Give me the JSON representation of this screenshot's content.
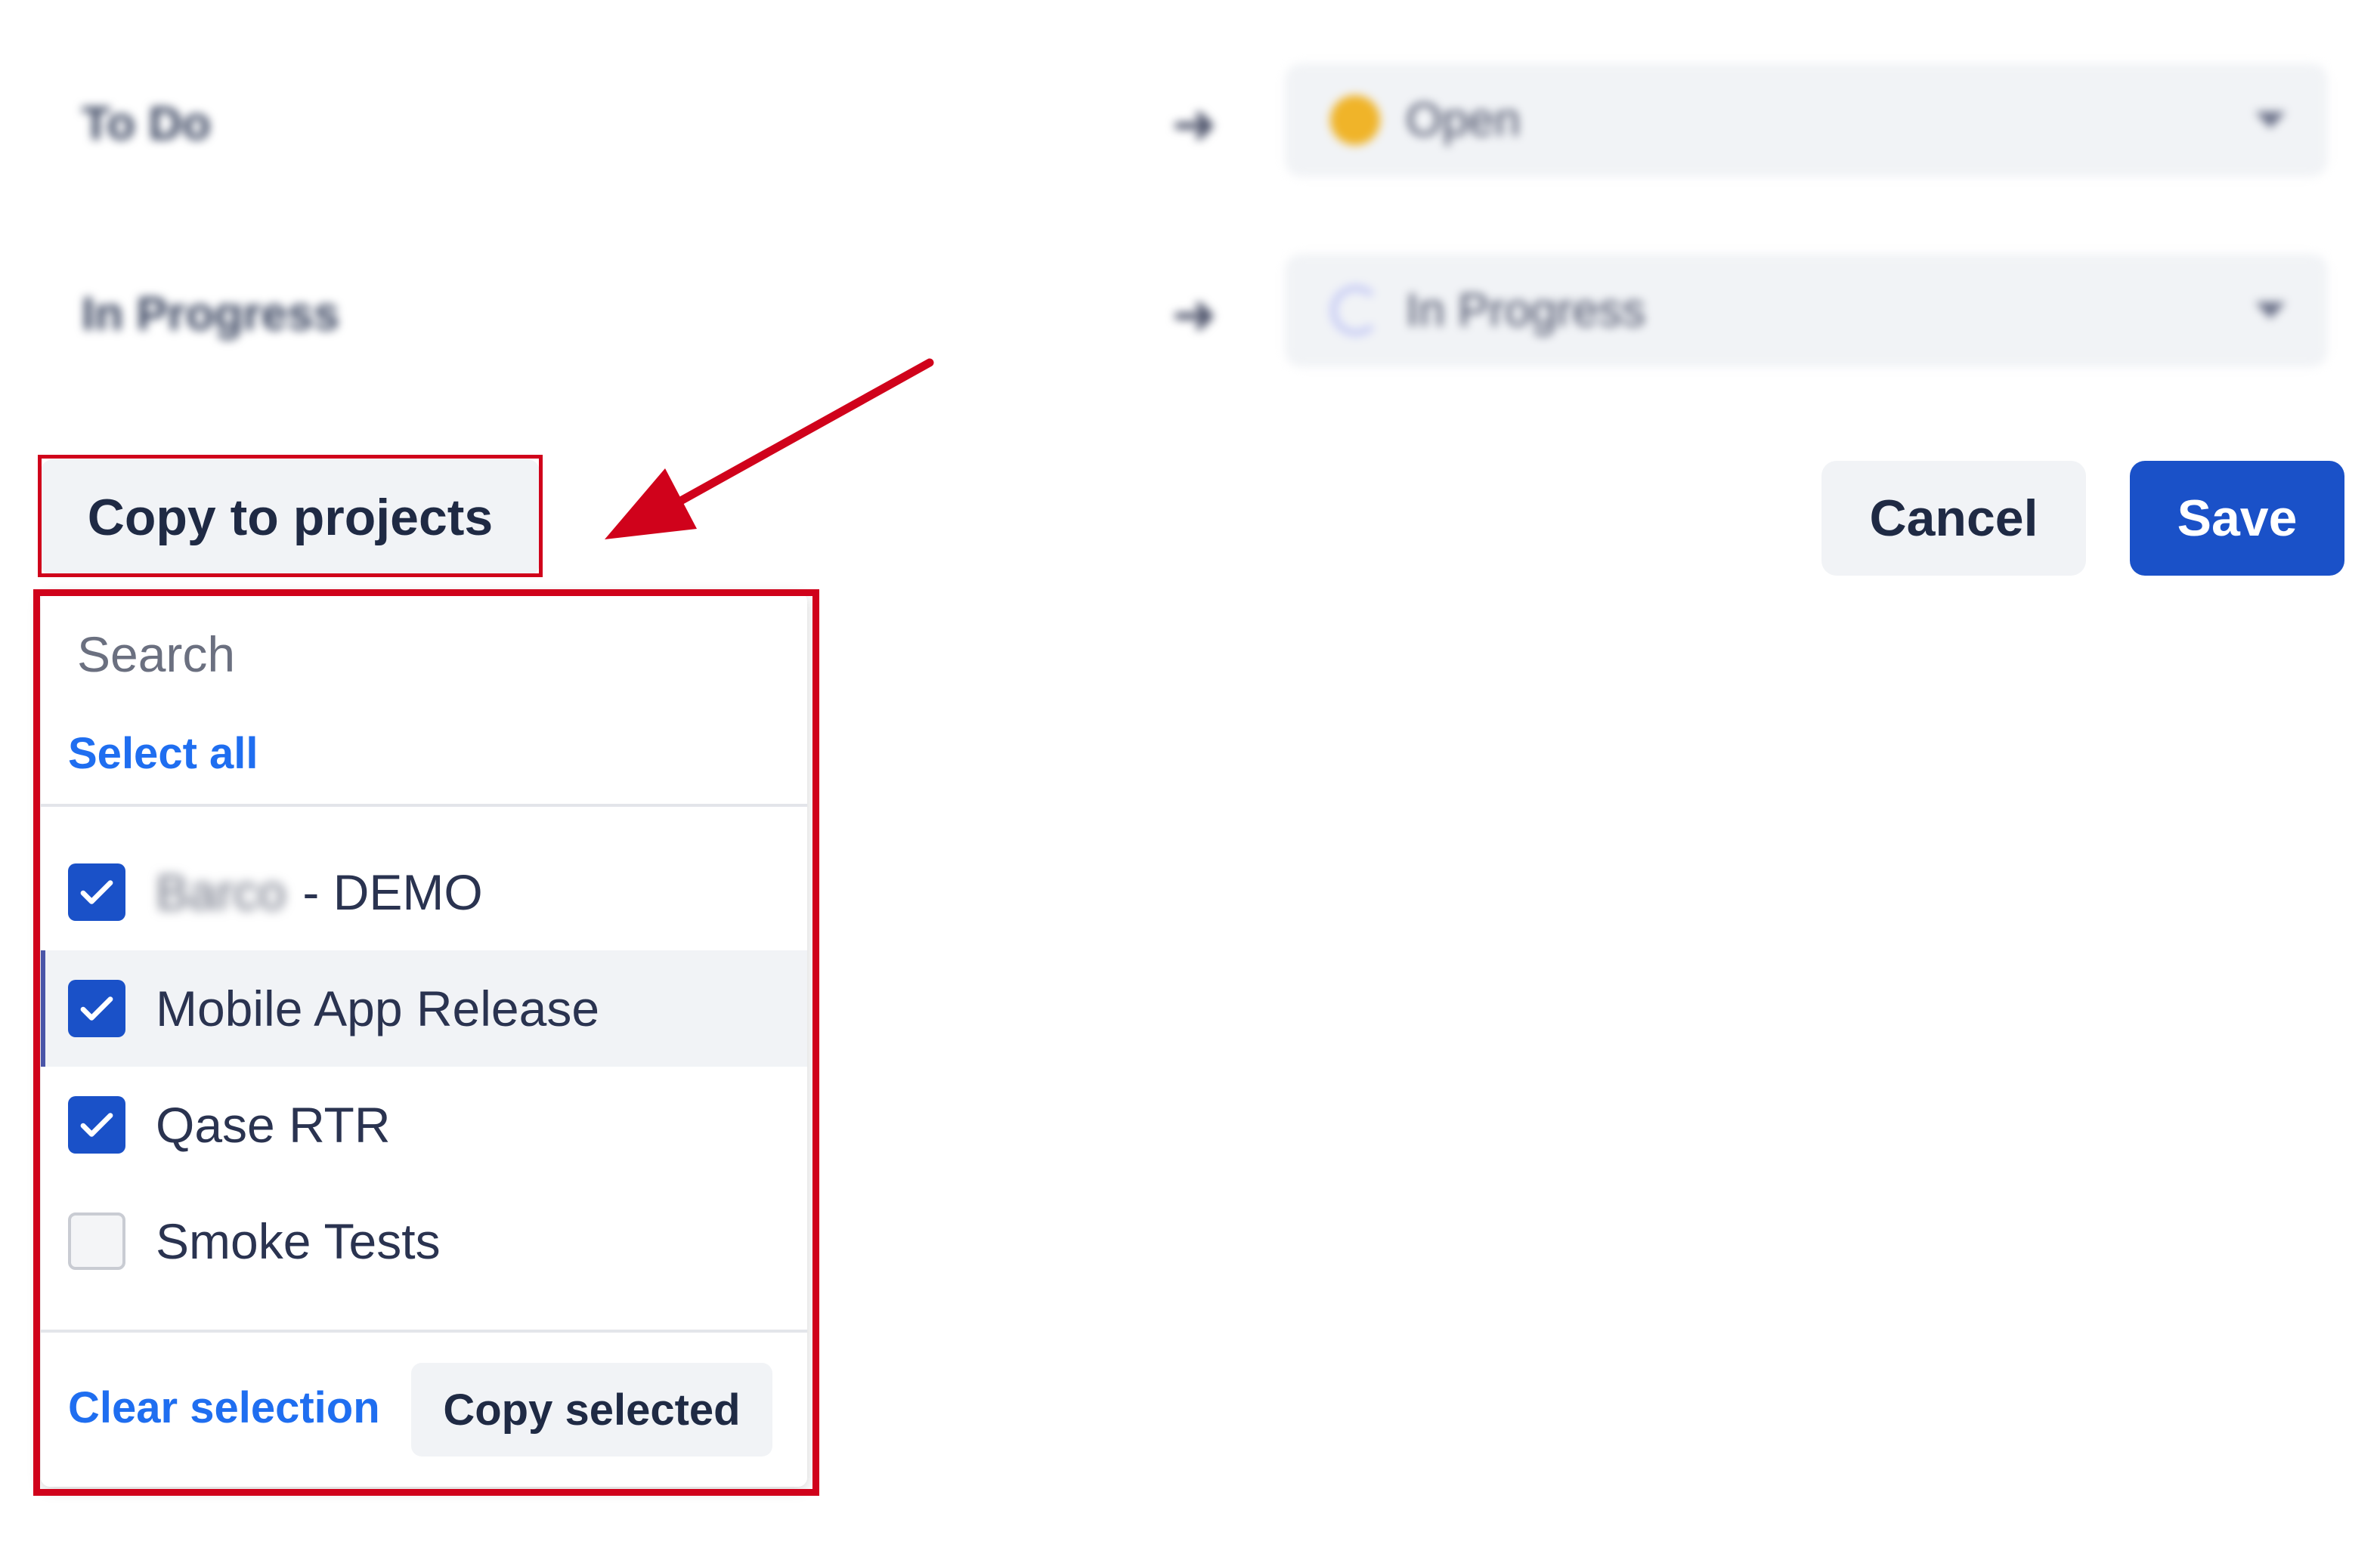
{
  "status_mappings": [
    {
      "source": "To Do",
      "target": "Open",
      "dot_color": "#f0b429"
    },
    {
      "source": "In Progress",
      "target": "In Progress",
      "dot_color": "#c8cdf5"
    }
  ],
  "actions": {
    "copy_to_projects": "Copy to projects",
    "cancel": "Cancel",
    "save": "Save"
  },
  "dropdown": {
    "search_placeholder": "Search",
    "select_all": "Select all",
    "items": [
      {
        "prefix": "Barco",
        "label": "- DEMO",
        "checked": true
      },
      {
        "label": "Mobile App Release",
        "checked": true
      },
      {
        "label": "Qase RTR",
        "checked": true
      },
      {
        "label": "Smoke Tests",
        "checked": false
      }
    ],
    "clear_selection": "Clear selection",
    "copy_selected": "Copy selected"
  },
  "colors": {
    "accent": "#1a51c8",
    "link": "#1f6ef0",
    "annotation": "#d0021b"
  }
}
